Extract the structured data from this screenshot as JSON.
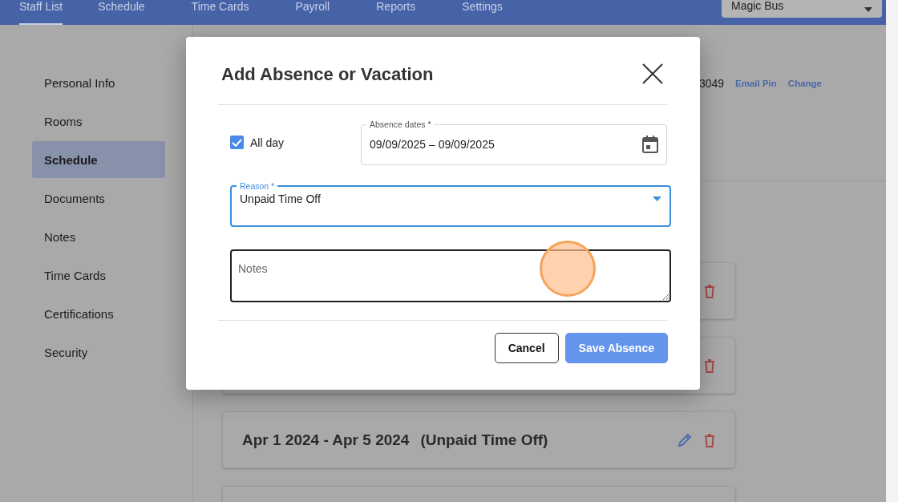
{
  "nav": {
    "tabs": [
      {
        "label": "Staff List",
        "selected": true
      },
      {
        "label": "Schedule",
        "selected": false
      },
      {
        "label": "Time Cards",
        "selected": false
      },
      {
        "label": "Payroll",
        "selected": false
      },
      {
        "label": "Reports",
        "selected": false
      },
      {
        "label": "Settings",
        "selected": false
      }
    ],
    "location_select": {
      "value": "Magic Bus"
    }
  },
  "sidebar": {
    "items": [
      {
        "label": "Personal Info",
        "selected": false
      },
      {
        "label": "Rooms",
        "selected": false
      },
      {
        "label": "Schedule",
        "selected": true
      },
      {
        "label": "Documents",
        "selected": false
      },
      {
        "label": "Notes",
        "selected": false
      },
      {
        "label": "Time Cards",
        "selected": false
      },
      {
        "label": "Certifications",
        "selected": false
      },
      {
        "label": "Security",
        "selected": false
      }
    ]
  },
  "account": {
    "pin": "3049",
    "links": [
      "Email Pin",
      "Change"
    ]
  },
  "cards": [
    {
      "kind": "covered"
    },
    {
      "kind": "covered"
    },
    {
      "kind": "entry",
      "dates": "Apr 1 2024 - Apr 5 2024",
      "reason": "(Unpaid Time Off)"
    },
    {
      "kind": "cut"
    }
  ],
  "dialog": {
    "title": "Add Absence or Vacation",
    "all_day": {
      "label": "All day",
      "checked": true
    },
    "dates": {
      "label": "Absence dates *",
      "value": "09/09/2025 – 09/09/2025"
    },
    "reason": {
      "label": "Reason *",
      "value": "Unpaid Time Off",
      "focused": true
    },
    "notes": {
      "placeholder": "Notes"
    },
    "buttons": [
      {
        "label": "Cancel",
        "kind": "secondary"
      },
      {
        "label": "Save Absence",
        "kind": "primary"
      }
    ]
  }
}
